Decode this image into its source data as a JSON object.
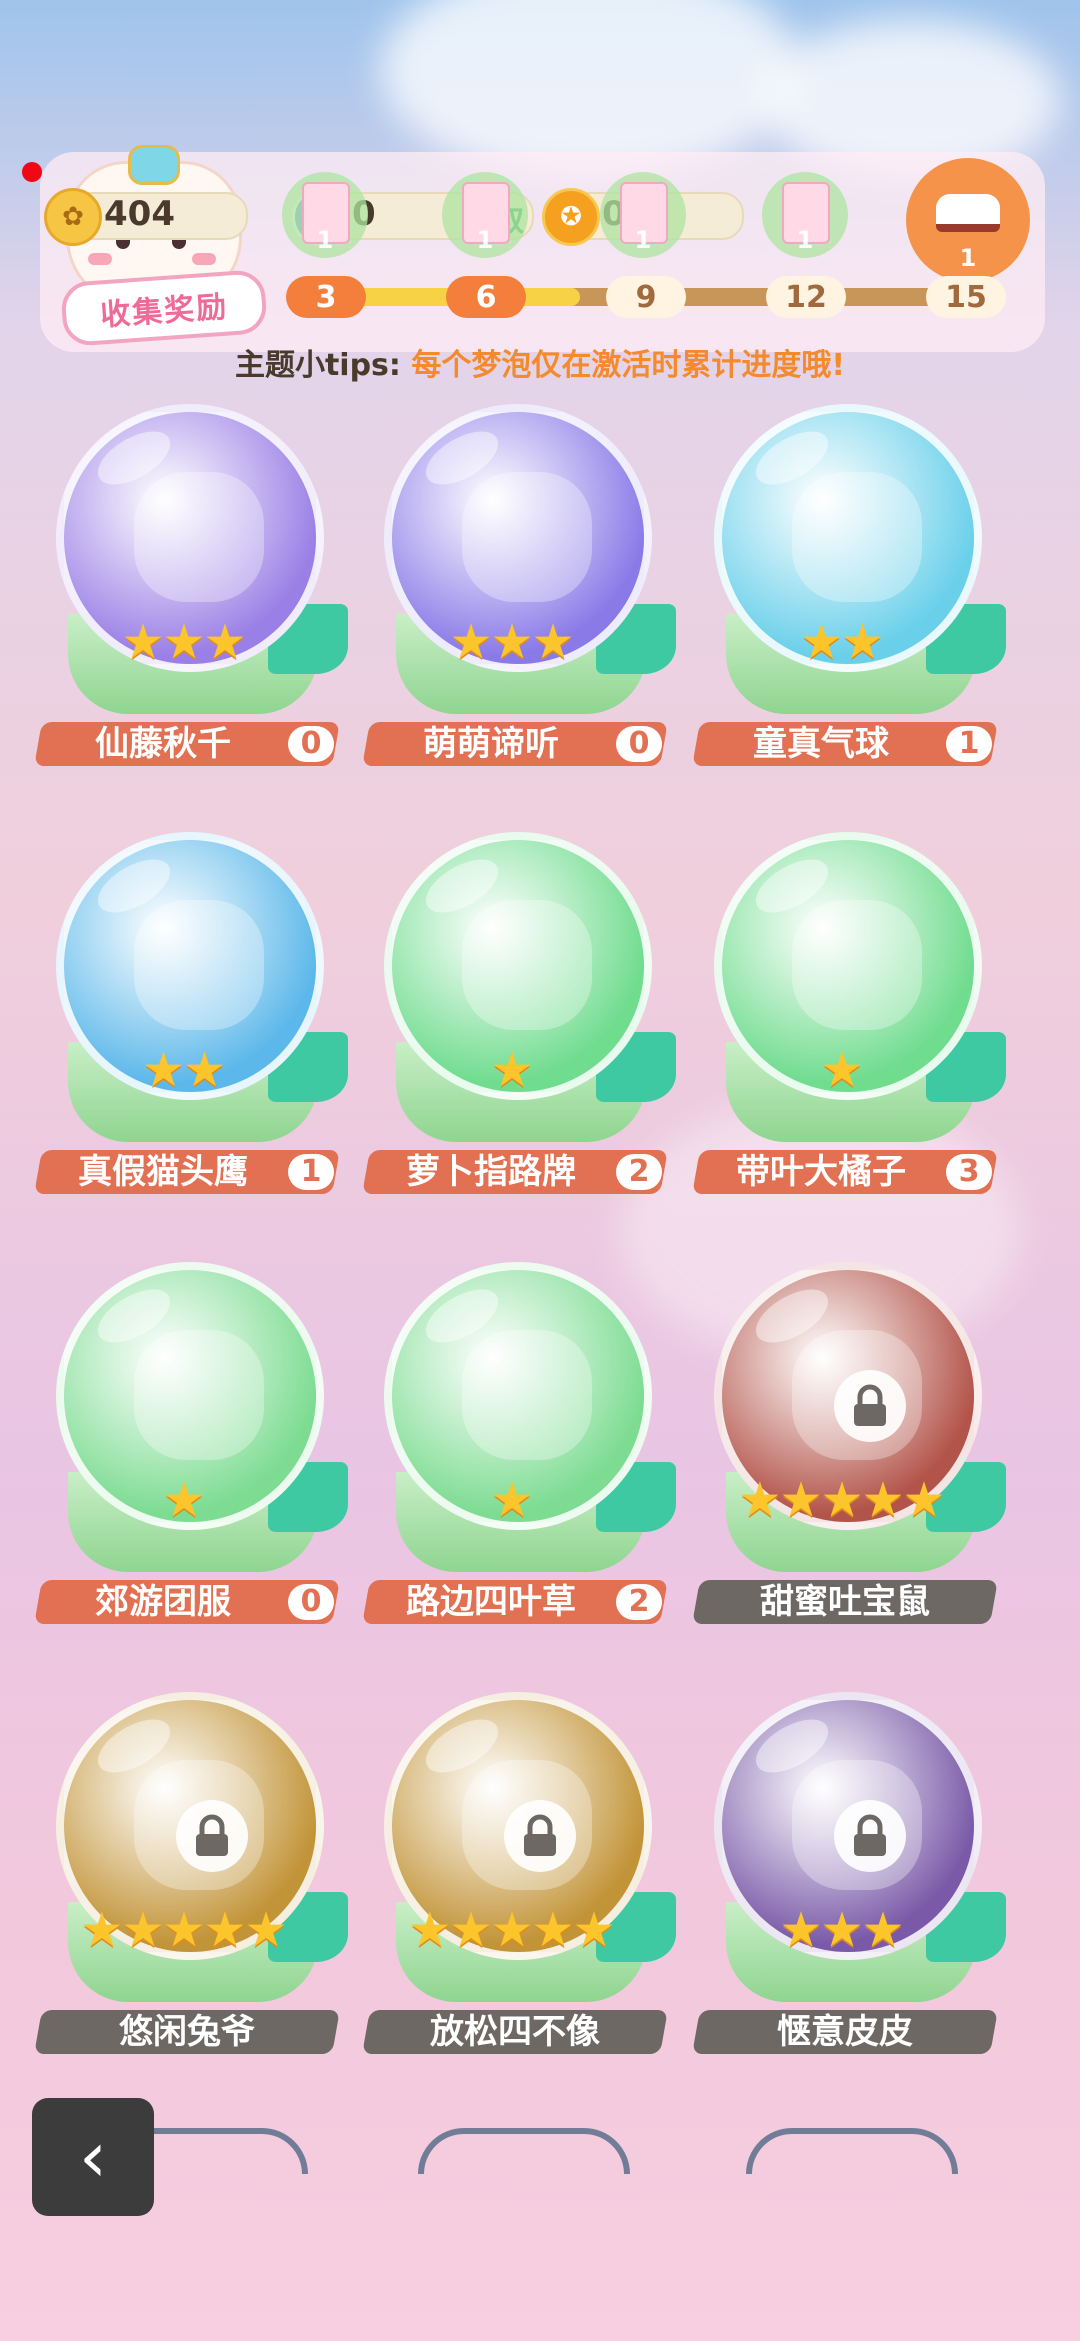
{
  "header": {
    "title_badge": "收集奖励",
    "currency": [
      {
        "icon": "gold-coin-icon",
        "value": "404"
      },
      {
        "icon": "blue-ticket-icon",
        "value": "0"
      },
      {
        "icon": "orange-coin-icon",
        "value": "0"
      }
    ],
    "claim_label": "取",
    "milestones": [
      {
        "step": "3",
        "reward_count": "1",
        "reached": true
      },
      {
        "step": "6",
        "reward_count": "1",
        "reached": true
      },
      {
        "step": "9",
        "reward_count": "1",
        "reached": false
      },
      {
        "step": "12",
        "reward_count": "1",
        "reached": false
      },
      {
        "step": "15",
        "reward_count": "1",
        "reached": false
      }
    ],
    "progress_fraction": 0.4,
    "tips_label": "主题小tips:",
    "tips_text": "每个梦泡仅在激活时累计进度哦!"
  },
  "cards": [
    {
      "name": "仙藤秋千",
      "count": "0",
      "stars": 3,
      "locked": false,
      "art": "swing-icon",
      "color": "#9a7fe6"
    },
    {
      "name": "萌萌谛听",
      "count": "0",
      "stars": 3,
      "locked": false,
      "art": "black-cat-icon",
      "color": "#8a7ae8"
    },
    {
      "name": "童真气球",
      "count": "1",
      "stars": 2,
      "locked": false,
      "art": "balloon-icon",
      "color": "#6ad0ea"
    },
    {
      "name": "真假猫头鹰",
      "count": "1",
      "stars": 2,
      "locked": false,
      "art": "owl-icon",
      "color": "#5cb8ea"
    },
    {
      "name": "萝卜指路牌",
      "count": "2",
      "stars": 1,
      "locked": false,
      "art": "signpost-icon",
      "color": "#6fdc8e"
    },
    {
      "name": "带叶大橘子",
      "count": "3",
      "stars": 1,
      "locked": false,
      "art": "orange-icon",
      "color": "#6fdc8e"
    },
    {
      "name": "郊游团服",
      "count": "0",
      "stars": 1,
      "locked": false,
      "art": "outfit-icon",
      "color": "#7ddc92"
    },
    {
      "name": "路边四叶草",
      "count": "2",
      "stars": 1,
      "locked": false,
      "art": "clover-icon",
      "color": "#7ddc92"
    },
    {
      "name": "甜蜜吐宝鼠",
      "count": "",
      "stars": 5,
      "locked": true,
      "art": "hamster-icon",
      "color": "#b3544a"
    },
    {
      "name": "悠闲兔爷",
      "count": "",
      "stars": 5,
      "locked": true,
      "art": "rabbit-icon",
      "color": "#c29438"
    },
    {
      "name": "放松四不像",
      "count": "",
      "stars": 5,
      "locked": true,
      "art": "deer-icon",
      "color": "#c29438"
    },
    {
      "name": "惬意皮皮",
      "count": "",
      "stars": 3,
      "locked": true,
      "art": "cat-icon",
      "color": "#7a5aa8"
    }
  ]
}
